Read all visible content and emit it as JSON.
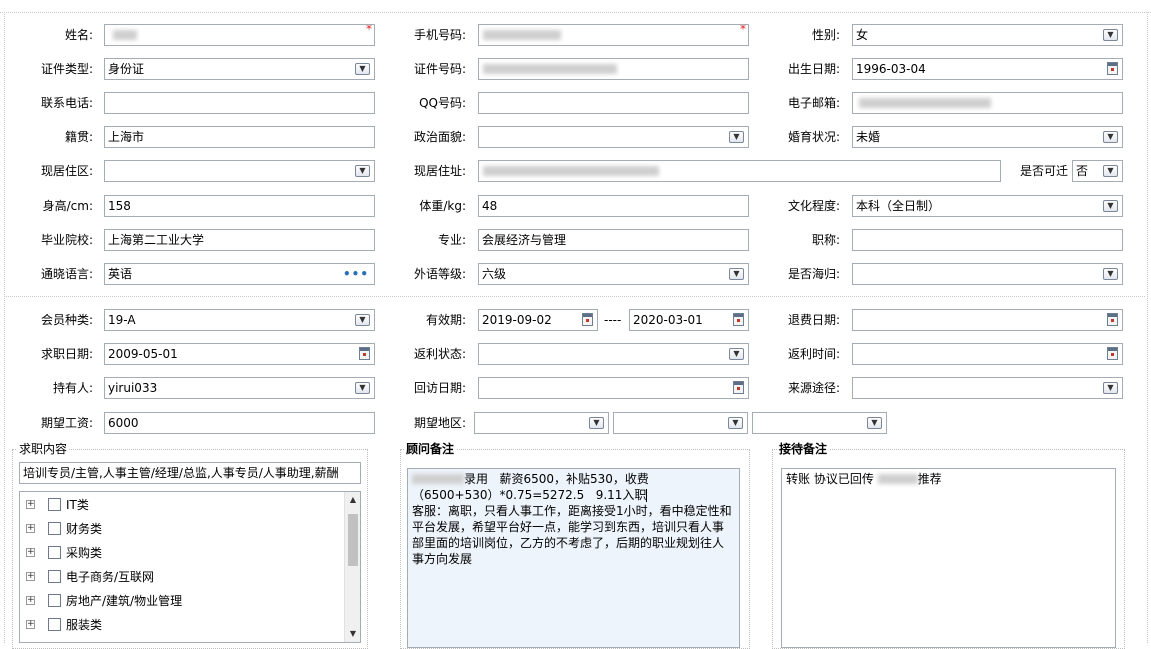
{
  "form": {
    "name": {
      "label": "姓名:",
      "required_mark": "*"
    },
    "mobile": {
      "label": "手机号码:",
      "required_mark": "*"
    },
    "gender": {
      "label": "性别:",
      "value": "女"
    },
    "id_type": {
      "label": "证件类型:",
      "value": "身份证"
    },
    "id_number": {
      "label": "证件号码:"
    },
    "birth_date": {
      "label": "出生日期:",
      "value": "1996-03-04"
    },
    "phone": {
      "label": "联系电话:",
      "value": ""
    },
    "qq": {
      "label": "QQ号码:",
      "value": ""
    },
    "email": {
      "label": "电子邮箱:"
    },
    "native_place": {
      "label": "籍贯:",
      "value": "上海市"
    },
    "political_status": {
      "label": "政治面貌:",
      "value": ""
    },
    "marital_status": {
      "label": "婚育状况:",
      "value": "未婚"
    },
    "residence_area": {
      "label": "现居住区:",
      "value": ""
    },
    "residence_address": {
      "label": "现居住址:"
    },
    "relocatable": {
      "label": "是否可迁",
      "value": "否"
    },
    "height": {
      "label": "身高/cm:",
      "value": "158"
    },
    "weight": {
      "label": "体重/kg:",
      "value": "48"
    },
    "education": {
      "label": "文化程度:",
      "value": "本科（全日制）"
    },
    "school": {
      "label": "毕业院校:",
      "value": "上海第二工业大学"
    },
    "major": {
      "label": "专业:",
      "value": "会展经济与管理"
    },
    "title": {
      "label": "职称:",
      "value": ""
    },
    "language": {
      "label": "通晓语言:",
      "value": "英语",
      "more": "•••"
    },
    "foreign_level": {
      "label": "外语等级:",
      "value": "六级"
    },
    "overseas": {
      "label": "是否海归:",
      "value": ""
    }
  },
  "membership": {
    "member_type": {
      "label": "会员种类:",
      "value": "19-A"
    },
    "validity": {
      "label": "有效期:",
      "start": "2019-09-02",
      "separator": "----",
      "end": "2020-03-01"
    },
    "refund_date": {
      "label": "退费日期:",
      "value": ""
    },
    "job_date": {
      "label": "求职日期:",
      "value": "2009-05-01"
    },
    "rebate_status": {
      "label": "返利状态:",
      "value": ""
    },
    "rebate_time": {
      "label": "返利时间:",
      "value": ""
    },
    "holder": {
      "label": "持有人:",
      "value": "yirui033"
    },
    "return_visit_date": {
      "label": "回访日期:",
      "value": ""
    },
    "source": {
      "label": "来源途径:",
      "value": ""
    },
    "expected_salary": {
      "label": "期望工资:",
      "value": "6000"
    },
    "expected_region": {
      "label": "期望地区:",
      "values": [
        "",
        "",
        ""
      ]
    }
  },
  "job_content": {
    "title": "求职内容",
    "summary": "培训专员/主管,人事主管/经理/总监,人事专员/人事助理,薪酬",
    "categories": [
      "IT类",
      "财务类",
      "采购类",
      "电子商务/互联网",
      "房地产/建筑/物业管理",
      "服装类"
    ]
  },
  "consultant_notes": {
    "title": "顾问备注",
    "text_line1": "录用   薪资6500，补贴530，收费",
    "text_line2": "（6500+530）*0.75=5272.5   9.11入职",
    "text_rest": "客服：离职，只看人事工作，距离接受1小时，看中稳定性和平台发展，希望平台好一点，能学习到东西，培训只看人事部里面的培训岗位，乙方的不考虑了，后期的职业规划往人事方向发展"
  },
  "reception_notes": {
    "title": "接待备注",
    "text_a": "转账 协议已回传",
    "text_b": "推荐"
  }
}
